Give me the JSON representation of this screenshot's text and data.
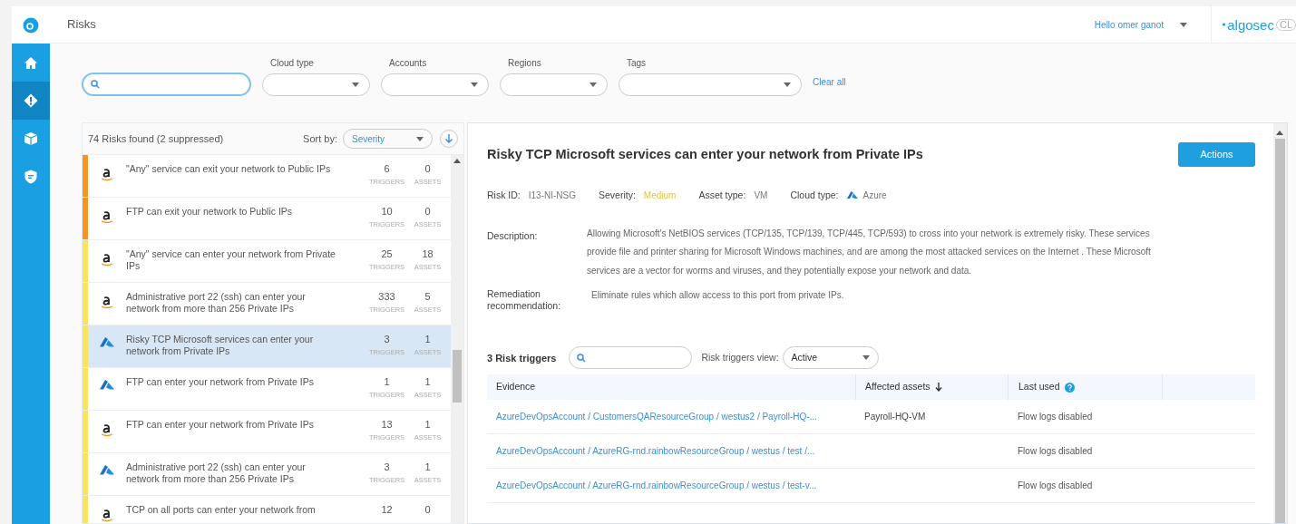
{
  "header": {
    "title": "Risks",
    "user_menu": "Hello omer ganot",
    "logo_text": "algosec",
    "logo_suffix": "CL"
  },
  "nav": [
    {
      "selected": false
    },
    {
      "selected": true
    },
    {
      "selected": false
    },
    {
      "selected": false
    }
  ],
  "filters": {
    "dropdowns": [
      {
        "label": "Cloud type"
      },
      {
        "label": "Accounts"
      },
      {
        "label": "Regions"
      },
      {
        "label": "Tags"
      }
    ],
    "clear": "Clear all"
  },
  "list": {
    "summary": "74 Risks found (2 suppressed)",
    "sort_label": "Sort by:",
    "sort_value": "Severity",
    "items": [
      {
        "title": "\"Any\" service can exit your network to Public IPs",
        "kind": "aws",
        "color": "#f7941d",
        "triggers": "6",
        "triggers_label": "TRIGGERS",
        "assets": "0",
        "assets_label": "ASSETS",
        "selected": false
      },
      {
        "title": "FTP can exit your network to Public IPs",
        "kind": "aws",
        "color": "#f7941d",
        "triggers": "10",
        "triggers_label": "TRIGGERS",
        "assets": "0",
        "assets_label": "ASSETS",
        "selected": false
      },
      {
        "title": "\"Any\" service can enter your network from Private IPs",
        "kind": "aws",
        "color": "#fde35a",
        "triggers": "25",
        "triggers_label": "TRIGGERS",
        "assets": "18",
        "assets_label": "ASSETS",
        "selected": false
      },
      {
        "title": "Administrative port 22 (ssh) can enter your network from more than 256 Private IPs",
        "kind": "aws",
        "color": "#fde35a",
        "triggers": "333",
        "triggers_label": "TRIGGERS",
        "assets": "5",
        "assets_label": "ASSETS",
        "selected": false
      },
      {
        "title": "Risky TCP Microsoft services can enter your network from Private IPs",
        "kind": "azure",
        "color": "#fde35a",
        "triggers": "3",
        "triggers_label": "TRIGGERS",
        "assets": "1",
        "assets_label": "ASSETS",
        "selected": true
      },
      {
        "title": "FTP can enter your network from Private IPs",
        "kind": "azure",
        "color": "#fde35a",
        "triggers": "1",
        "triggers_label": "TRIGGERS",
        "assets": "1",
        "assets_label": "ASSETS",
        "selected": false
      },
      {
        "title": "FTP can enter your network from Private IPs",
        "kind": "aws",
        "color": "#fde35a",
        "triggers": "13",
        "triggers_label": "TRIGGERS",
        "assets": "1",
        "assets_label": "ASSETS",
        "selected": false
      },
      {
        "title": "Administrative port 22 (ssh) can enter your network from more than 256 Private IPs",
        "kind": "azure",
        "color": "#fde35a",
        "triggers": "3",
        "triggers_label": "TRIGGERS",
        "assets": "1",
        "assets_label": "ASSETS",
        "selected": false
      },
      {
        "title": "TCP on all ports can enter your network from",
        "kind": "aws",
        "color": "#fde35a",
        "triggers": "12",
        "assets": "0",
        "selected": false
      }
    ]
  },
  "detail": {
    "title": "Risky TCP Microsoft services can enter your network from Private IPs",
    "actions": "Actions",
    "meta": [
      {
        "label": "Risk ID:",
        "value": "I13-NI-NSG",
        "kind": "plain"
      },
      {
        "label": "Severity:",
        "value": "Medium",
        "kind": "severity"
      },
      {
        "label": "Asset type:",
        "value": "VM",
        "kind": "plain"
      },
      {
        "label": "Cloud type:",
        "value": "Azure",
        "kind": "cloud"
      }
    ],
    "description_label": "Description:",
    "description": "Allowing Microsoft's NetBIOS services (TCP/135, TCP/139, TCP/445, TCP/593) to cross into your network is extremely risky. These services provide file and printer sharing for Microsoft Windows machines, and are among the most attacked services on the Internet . These Microsoft services are a vector for worms and viruses, and they potentially expose your network and data.",
    "remediation_label": "Remediation recommendation:",
    "remediation": "Eliminate rules which allow access to this port from private IPs.",
    "triggers": {
      "count": "3 Risk triggers",
      "view_label": "Risk triggers view:",
      "view_value": "Active",
      "columns": [
        "Evidence",
        "Affected assets",
        "Last used"
      ],
      "rows": [
        {
          "evidence": "AzureDevOpsAccount / CustomersQAResourceGroup / westus2 / Payroll-HQ-...",
          "asset": "Payroll-HQ-VM",
          "last_used": "Flow logs disabled"
        },
        {
          "evidence": "AzureDevOpsAccount / AzureRG-rnd.rainbowResourceGroup / westus / test /...",
          "asset": "",
          "last_used": "Flow logs disabled"
        },
        {
          "evidence": "AzureDevOpsAccount / AzureRG-rnd.rainbowResourceGroup / westus / test-v...",
          "asset": "",
          "last_used": "Flow logs disabled"
        }
      ]
    }
  }
}
